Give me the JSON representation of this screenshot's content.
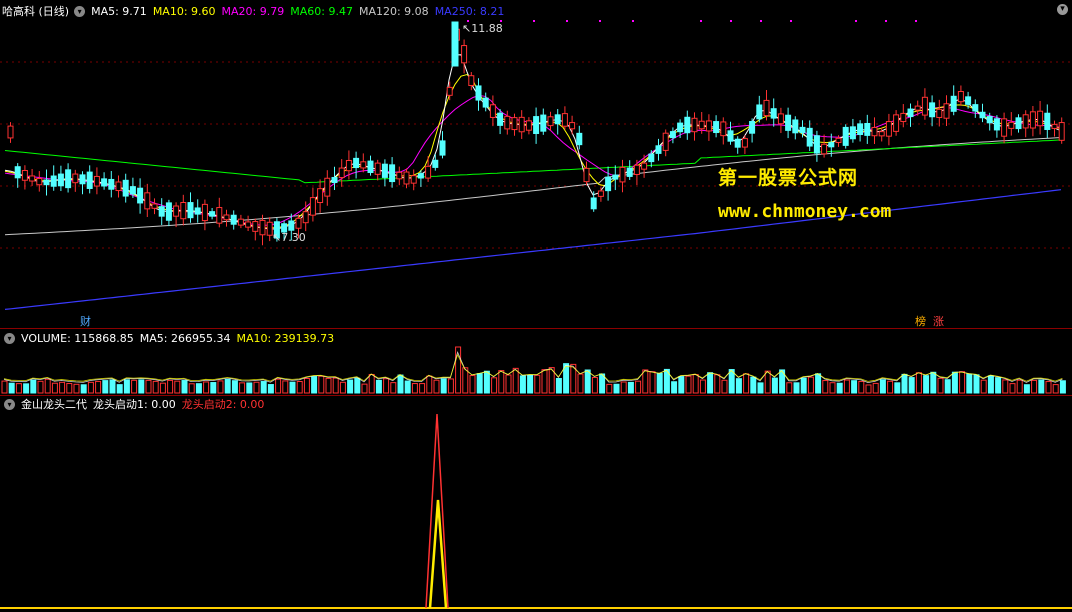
{
  "colors": {
    "up": "#ff3232",
    "down": "#54ffff",
    "ma5": "#ffffff",
    "ma10": "#ffff00",
    "ma20": "#ff00ff",
    "ma60": "#00ff00",
    "ma120": "#c8c8c8",
    "ma250": "#3a3aff",
    "red": "#ff3232"
  },
  "main": {
    "stock_title": "哈高科 (日线)",
    "ma5_label": "MA5: 9.71",
    "ma10_label": "MA10: 9.60",
    "ma20_label": "MA20: 9.79",
    "ma60_label": "MA60: 9.47",
    "ma120_label": "MA120: 9.08",
    "ma250_label": "MA250: 8.21",
    "high_marker": "11.88",
    "low_marker": "7.30",
    "watermark_name": "第一股票公式网",
    "watermark_url": "www.chnmoney.com",
    "event_tags": [
      "财",
      "榜",
      "涨"
    ]
  },
  "volume": {
    "title": "VOLUME: 115868.85",
    "ma5_label": "MA5: 266955.34",
    "ma10_label": "MA10: 239139.73"
  },
  "indicator": {
    "name": "金山龙头二代",
    "line1_label": "龙头启动1: 0.00",
    "line2_label": "龙头启动2: 0.00"
  }
}
